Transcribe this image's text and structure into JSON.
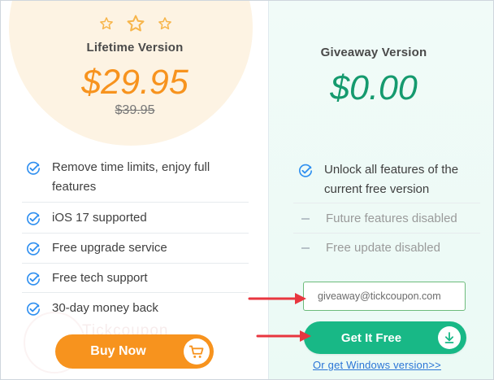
{
  "lifetime": {
    "title": "Lifetime Version",
    "price": "$29.95",
    "old_price": "$39.95",
    "features": [
      "Remove time limits, enjoy full features",
      "iOS 17 supported",
      "Free upgrade service",
      "Free tech support",
      "30-day money back"
    ],
    "buy_label": "Buy Now",
    "accent_color": "#f7931e",
    "star_count": 3
  },
  "giveaway": {
    "title": "Giveaway Version",
    "price": "$0.00",
    "features": [
      {
        "text": "Unlock all features of the current free version",
        "icon": "check-circle-icon"
      },
      {
        "text": "Future features disabled",
        "icon": "dash-icon"
      },
      {
        "text": "Free update disabled",
        "icon": "dash-icon"
      }
    ],
    "email_value": "giveaway@tickcoupon.com",
    "get_label": "Get It Free",
    "windows_link": "Or get Windows version>>",
    "accent_color": "#18b886"
  },
  "watermark": "Tickcoupon",
  "annotation_color": "#e8363f"
}
